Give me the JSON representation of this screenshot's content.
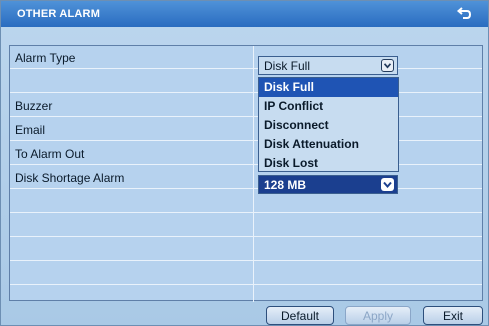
{
  "window": {
    "title": "OTHER ALARM"
  },
  "rows": [
    {
      "label": "Alarm Type"
    },
    {
      "label": ""
    },
    {
      "label": "Buzzer"
    },
    {
      "label": "Email"
    },
    {
      "label": "To Alarm Out"
    },
    {
      "label": "Disk Shortage Alarm"
    },
    {
      "label": ""
    },
    {
      "label": ""
    },
    {
      "label": ""
    },
    {
      "label": ""
    },
    {
      "label": ""
    }
  ],
  "alarm_type": {
    "selected": "Disk Full",
    "options": [
      "Disk Full",
      "IP Conflict",
      "Disconnect",
      "Disk Attenuation",
      "Disk Lost"
    ],
    "highlighted_index": 0
  },
  "disk_shortage": {
    "selected": "128 MB"
  },
  "buttons": {
    "default": "Default",
    "apply": "Apply",
    "exit": "Exit"
  },
  "colors": {
    "title_bar": "#2a6cc0",
    "panel": "#b6d2ee",
    "highlight": "#1f54b4",
    "disabled_text": "#8ca6c6"
  },
  "icons": {
    "back": "back-arrow-icon",
    "dropdown": "chevron-down-icon"
  }
}
